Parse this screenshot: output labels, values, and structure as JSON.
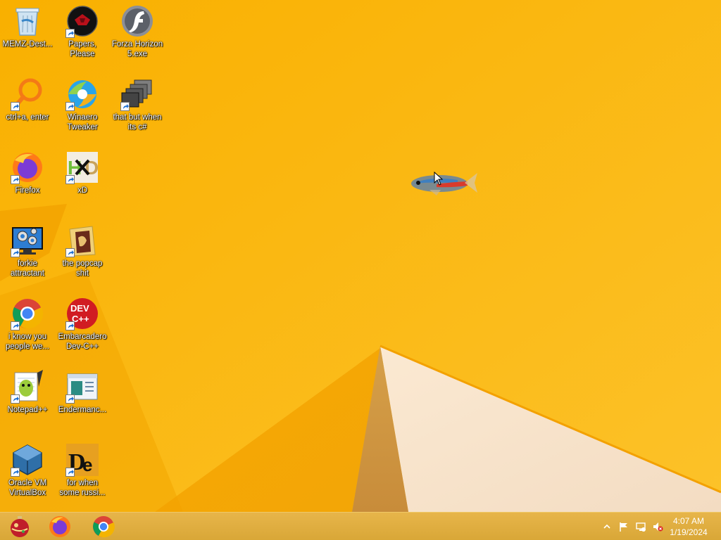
{
  "desktop": {
    "icons": [
      {
        "label": "MEMZ-Dest...",
        "icon": "recycle-bin-icon",
        "shortcut": false
      },
      {
        "label": "Papers, Please",
        "icon": "papers-please-icon",
        "shortcut": true
      },
      {
        "label": "Forza Horizon\n5.exe",
        "icon": "flash-player-icon",
        "shortcut": false
      },
      {
        "label": "ctrl+a, enter",
        "icon": "magnifier-icon",
        "shortcut": true
      },
      {
        "label": "Winaero\nTweaker",
        "icon": "winaero-tweaker-icon",
        "shortcut": true
      },
      {
        "label": "that but when\nits c#",
        "icon": "stacked-windows-icon",
        "shortcut": true
      },
      {
        "label": "Firefox",
        "icon": "firefox-icon",
        "shortcut": true
      },
      {
        "label": "xD",
        "icon": "hxd-icon",
        "shortcut": true
      },
      {
        "label": "forkie\nattractant",
        "icon": "monitor-gears-icon",
        "shortcut": true
      },
      {
        "label": "the popcap\nshit",
        "icon": "folder-icon",
        "shortcut": true
      },
      {
        "label": "i know you\npeople we...",
        "icon": "chrome-icon",
        "shortcut": true
      },
      {
        "label": "Embarcadero\nDev-C++",
        "icon": "dev-cpp-icon",
        "shortcut": true
      },
      {
        "label": "Notepad++",
        "icon": "notepad-plus-plus-icon",
        "shortcut": true
      },
      {
        "label": "Endermanc...",
        "icon": "window-app-icon",
        "shortcut": true
      },
      {
        "label": "Oracle VM\nVirtualBox",
        "icon": "virtualbox-icon",
        "shortcut": true
      },
      {
        "label": "for when\nsome russi...",
        "icon": "de-icon",
        "shortcut": true
      }
    ]
  },
  "taskbar": {
    "pinned": [
      "ornament-icon",
      "firefox-icon",
      "chrome-icon"
    ],
    "tray_icons": [
      "show-hidden-icons-chevron",
      "action-center-flag-icon",
      "network-icon",
      "volume-muted-icon"
    ],
    "clock": {
      "time": "4:07 AM",
      "date": "1/19/2024"
    }
  },
  "colors": {
    "wallpaper": "#f8b400",
    "taskbar": "#dcaa3a"
  }
}
